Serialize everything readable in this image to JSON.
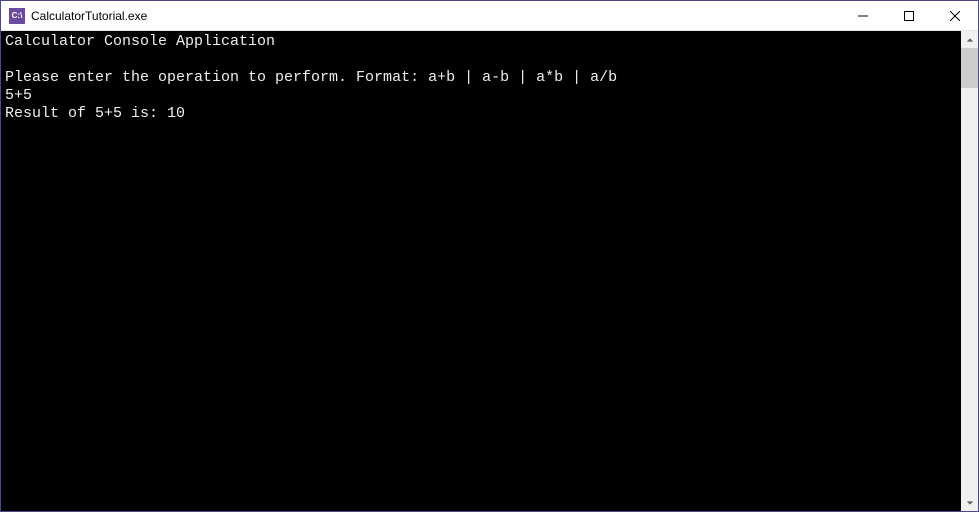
{
  "window": {
    "title": "CalculatorTutorial.exe",
    "icon_text": "C:\\"
  },
  "console": {
    "lines": [
      "Calculator Console Application",
      "",
      "Please enter the operation to perform. Format: a+b | a-b | a*b | a/b",
      "5+5",
      "Result of 5+5 is: 10"
    ]
  }
}
